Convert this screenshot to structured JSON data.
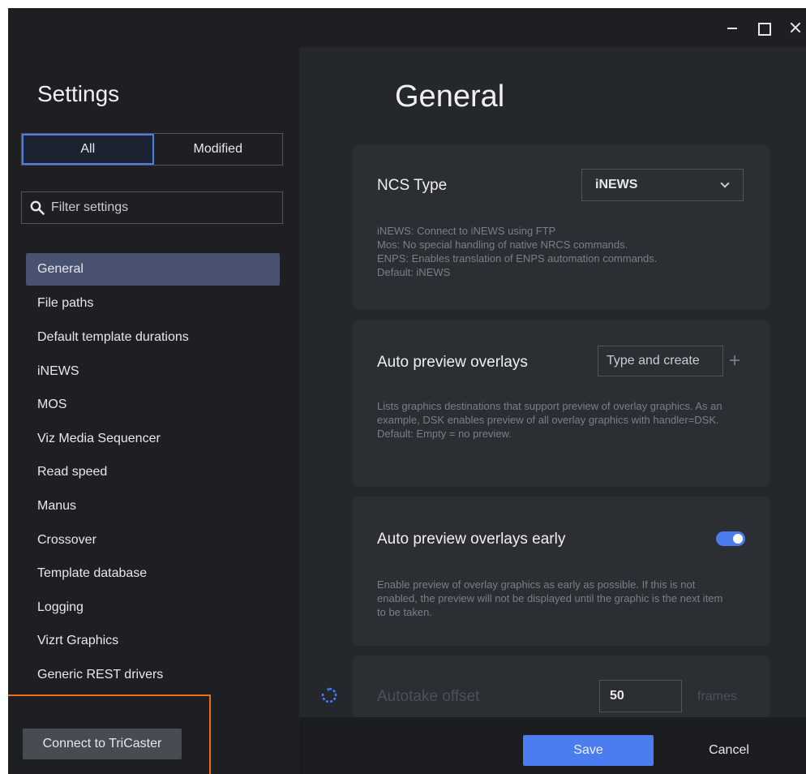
{
  "window": {
    "controls": {
      "minimize": "minimize",
      "maximize": "maximize",
      "close": "close"
    }
  },
  "sidebar": {
    "title": "Settings",
    "filter_tabs": [
      {
        "label": "All",
        "active": true
      },
      {
        "label": "Modified",
        "active": false
      }
    ],
    "search": {
      "placeholder": "Filter settings",
      "value": ""
    },
    "items": [
      {
        "label": "General",
        "active": true
      },
      {
        "label": "File paths"
      },
      {
        "label": "Default template durations"
      },
      {
        "label": "iNEWS"
      },
      {
        "label": "MOS"
      },
      {
        "label": "Viz Media Sequencer"
      },
      {
        "label": "Read speed"
      },
      {
        "label": "Manus"
      },
      {
        "label": "Crossover"
      },
      {
        "label": "Template database"
      },
      {
        "label": "Logging"
      },
      {
        "label": "Vizrt Graphics"
      },
      {
        "label": "Generic REST drivers"
      }
    ],
    "tricaster_button": "Connect to TriCaster"
  },
  "main": {
    "title": "General",
    "ncs_type": {
      "label": "NCS Type",
      "selected": "iNEWS",
      "description": "iNEWS: Connect to iNEWS using FTP\nMos: No special handling of native NRCS commands.\nENPS: Enables translation of ENPS automation commands.\nDefault: iNEWS"
    },
    "auto_preview_overlays": {
      "label": "Auto preview overlays",
      "placeholder": "Type and create",
      "description": "Lists graphics destinations that support preview of overlay graphics. As an example, DSK enables preview of all overlay graphics with handler=DSK.\nDefault: Empty = no preview."
    },
    "auto_preview_overlays_early": {
      "label": "Auto preview overlays early",
      "enabled": true,
      "description": "Enable preview of overlay graphics as early as possible. If this is not enabled, the preview will not be displayed until the graphic is the next item to be taken."
    },
    "autotake_offset": {
      "label": "Autotake offset",
      "value": "50",
      "unit": "frames"
    }
  },
  "footer": {
    "save": "Save",
    "cancel": "Cancel"
  },
  "colors": {
    "accent": "#4b7cf0",
    "highlight": "#f06a1a",
    "selected_nav": "#4a5272"
  }
}
